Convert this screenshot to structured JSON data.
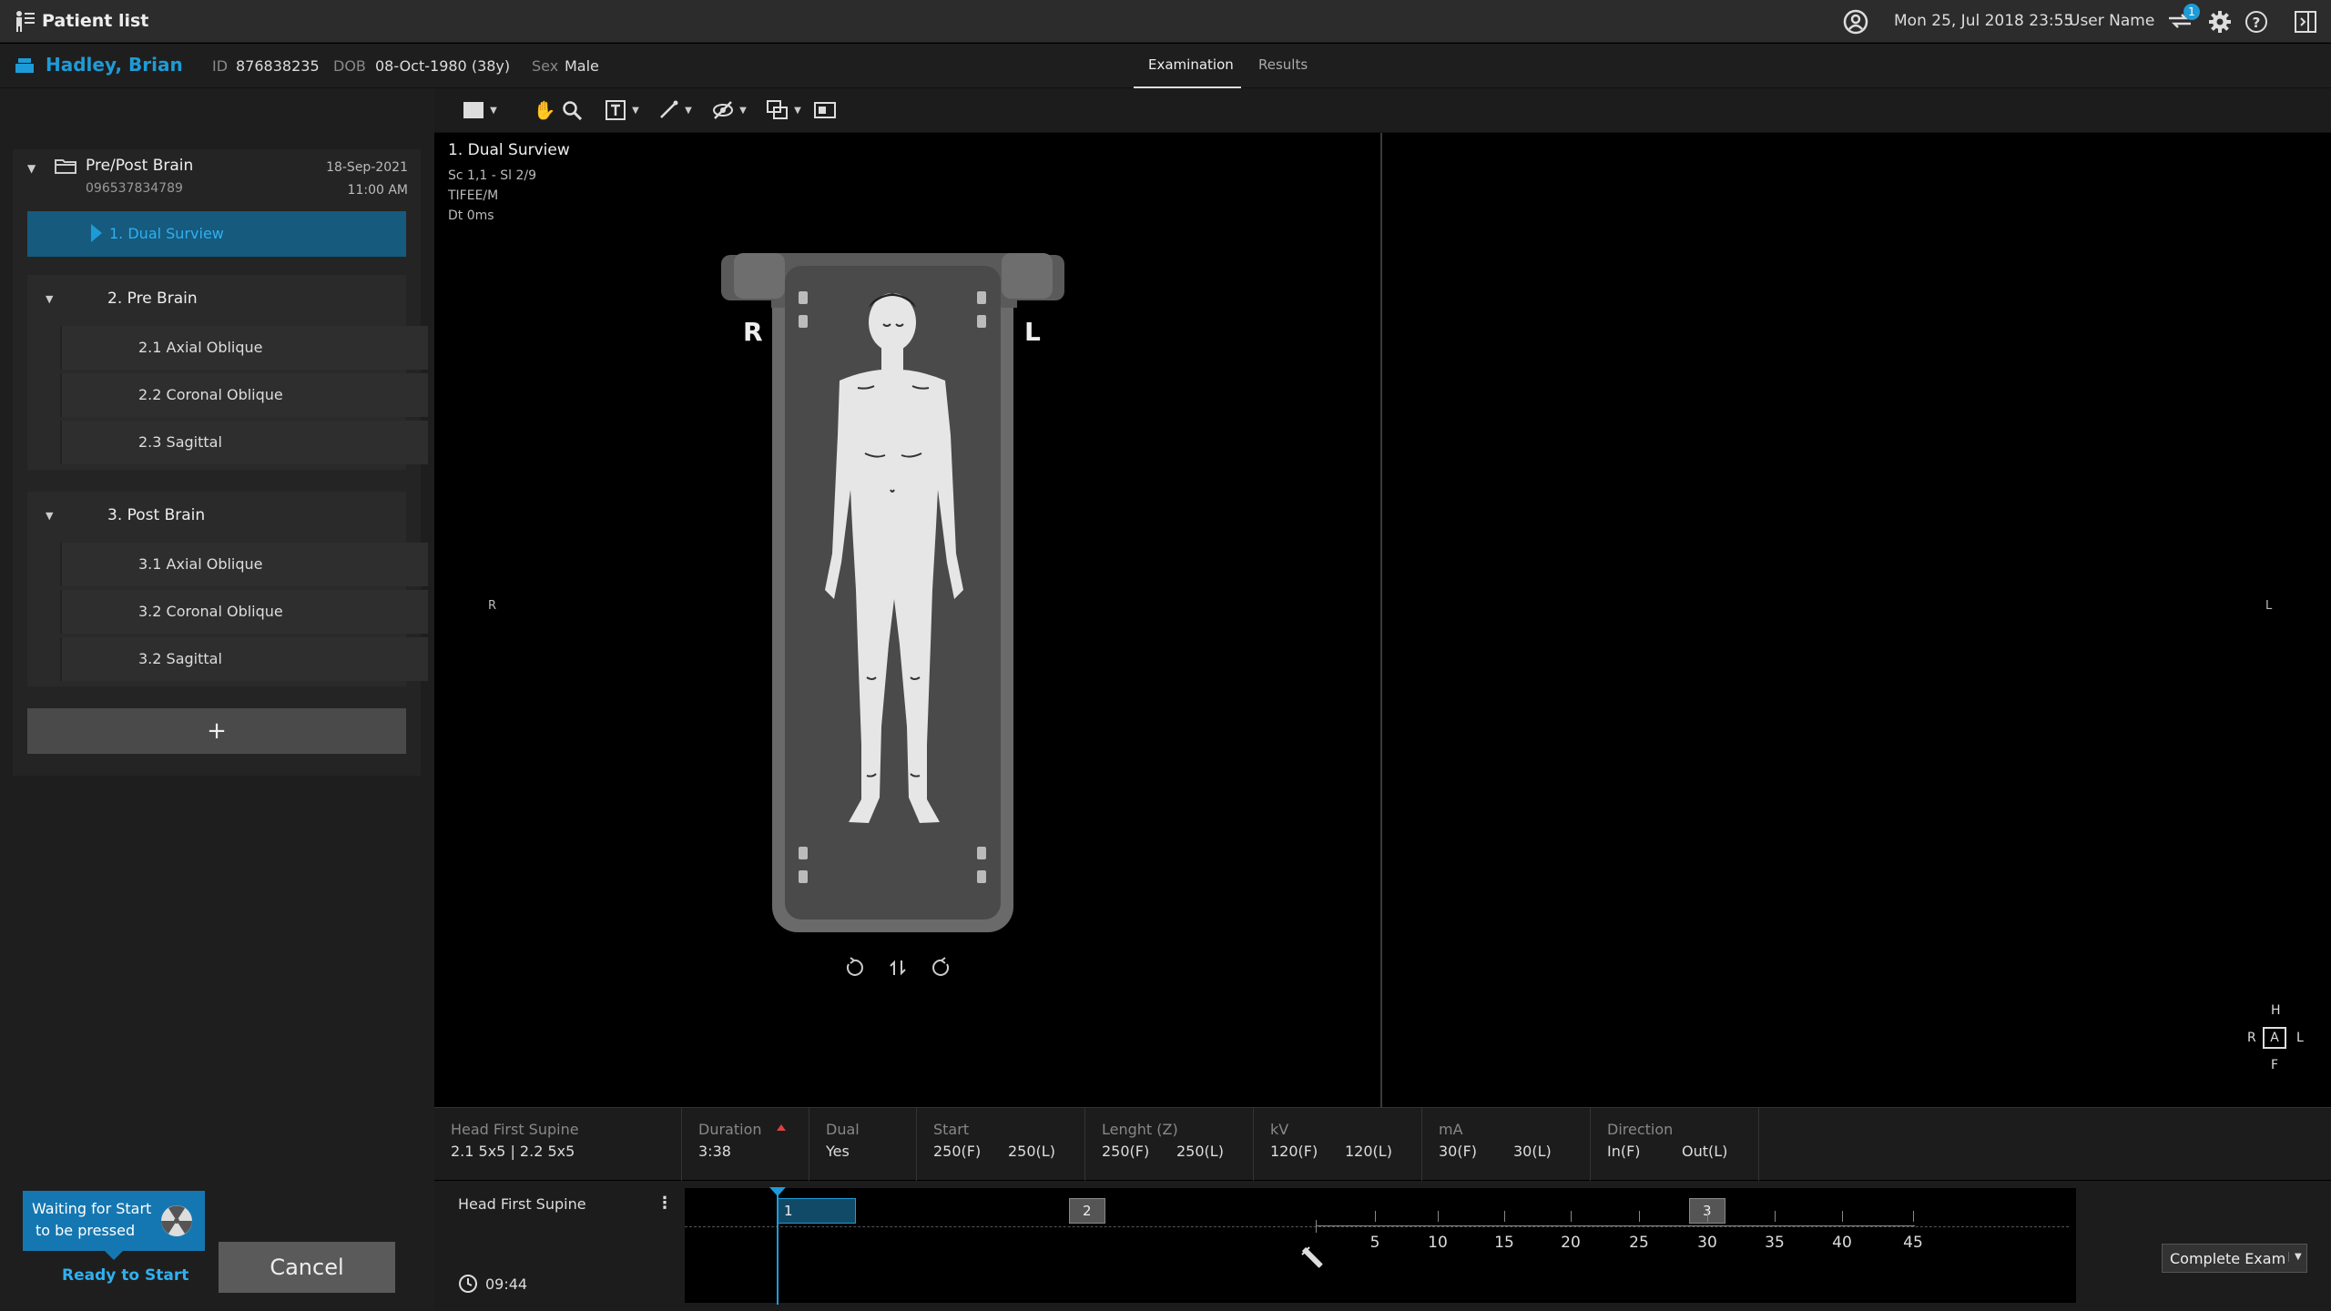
{
  "topbar": {
    "title": "Patient list",
    "datetime": "Mon 25, Jul 2018  23:55",
    "user": "User Name",
    "notification_count": "1"
  },
  "patient": {
    "name": "Hadley, Brian",
    "id_label": "ID",
    "id_value": "876838235",
    "dob_label": "DOB",
    "dob_value": "08-Oct-1980 (38y)",
    "sex_label": "Sex",
    "sex_value": "Male"
  },
  "tabs": [
    {
      "label": "Examination",
      "active": true
    },
    {
      "label": "Results",
      "active": false
    }
  ],
  "exam": {
    "name": "Pre/Post Brain",
    "number": "096537834789",
    "date": "18-Sep-2021",
    "time": "11:00 AM",
    "selected": "1. Dual Surview",
    "groups": [
      {
        "label": "2. Pre Brain",
        "items": [
          "2.1 Axial Oblique",
          "2.2 Coronal Oblique",
          "2.3 Sagittal"
        ]
      },
      {
        "label": "3. Post Brain",
        "items": [
          "3.1 Axial Oblique",
          "3.2 Coronal Oblique",
          "3.2 Sagittal"
        ]
      }
    ],
    "add_label": "+"
  },
  "viewer": {
    "title": "1. Dual Surview",
    "line1": "Sc 1,1 - Sl 2/9",
    "line2": "TIFEE/M",
    "line3": "Dt 0ms",
    "orient_h": "H",
    "orient_f": "F",
    "orient_r": "R",
    "orient_l": "L",
    "body_r": "R",
    "body_l": "L",
    "cube_h": "H",
    "cube_a": "A",
    "cube_f": "F",
    "cube_r": "R",
    "cube_l": "L"
  },
  "params": [
    {
      "label": "Head First Supine",
      "values": [
        "2.1 5x5  |  2.2 5x5"
      ]
    },
    {
      "label": "Duration",
      "values": [
        "3:38"
      ]
    },
    {
      "label": "Dual",
      "values": [
        "Yes"
      ]
    },
    {
      "label": "Start",
      "values": [
        "250(F)",
        "250(L)"
      ]
    },
    {
      "label": "Lenght (Z)",
      "values": [
        "250(F)",
        "250(L)"
      ]
    },
    {
      "label": "kV",
      "values": [
        "120(F)",
        "120(L)"
      ]
    },
    {
      "label": "mA",
      "values": [
        "30(F)",
        "30(L)"
      ]
    },
    {
      "label": "Direction",
      "values": [
        "In(F)",
        "Out(L)"
      ]
    }
  ],
  "bottom": {
    "status_line1": "Waiting for Start",
    "status_line2": "to be pressed",
    "ready": "Ready to Start",
    "cancel": "Cancel",
    "position": "Head First Supine",
    "time": "09:44",
    "complete": "Complete Exam"
  },
  "timeline": {
    "markers": [
      "1",
      "2",
      "3"
    ],
    "ticks": [
      "5",
      "10",
      "15",
      "20",
      "25",
      "30",
      "35",
      "40",
      "45"
    ]
  },
  "colors": {
    "accent": "#1e9bd7",
    "selected_bg": "#165a7e",
    "status_bg": "#1577b1"
  }
}
